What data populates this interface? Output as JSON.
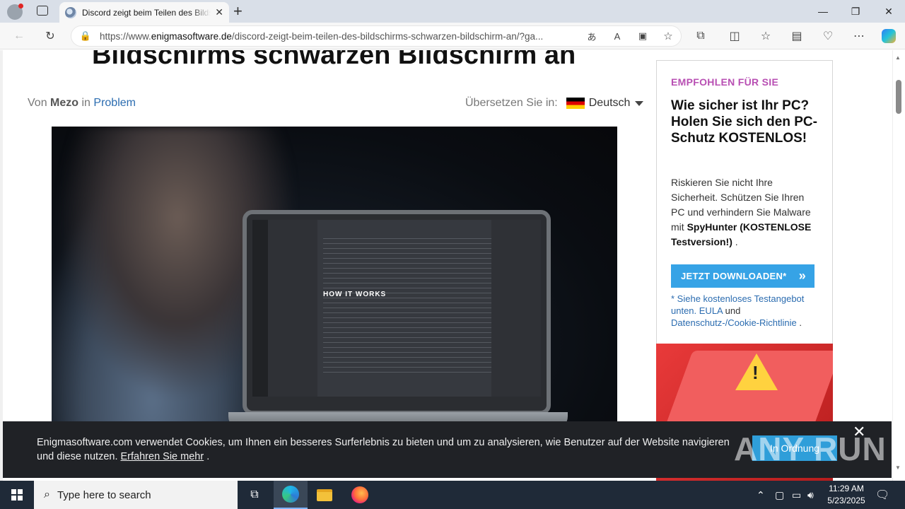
{
  "browser": {
    "tab_title": "Discord zeigt beim Teilen des Bildschirms schwarzen Bildschirm an",
    "url_prefix": "https://www.",
    "url_domain": "enigmasoftware.de",
    "url_path": "/discord-zeigt-beim-teilen-des-bildschirms-schwarzen-bildschirm-an/?ga..."
  },
  "article": {
    "headline": "Bildschirms schwarzen Bildschirm an",
    "by_prefix": "Von",
    "author": "Mezo",
    "in_word": "in",
    "category": "Problem",
    "translate_label": "Übersetzen Sie in:",
    "language": "Deutsch"
  },
  "ad": {
    "kicker": "EMPFOHLEN FÜR SIE",
    "title": "Wie sicher ist Ihr PC? Holen Sie sich den PC-Schutz KOSTENLOS!",
    "body_plain": "Riskieren Sie nicht Ihre Sicherheit. Schützen Sie Ihren PC und verhindern Sie Malware mit ",
    "body_bold": "SpyHunter (KOSTENLOSE Testversion!)",
    "body_end": " .",
    "button": "JETZT DOWNLOADEN*",
    "note_link1": "* Siehe kostenloses Testangebot unten. EULA",
    "note_and": " und ",
    "note_link2": "Datenschutz-/Cookie-Richtlinie",
    "note_end": " ."
  },
  "cookie": {
    "message": "Enigmasoftware.com verwendet Cookies, um Ihnen ein besseres Surferlebnis zu bieten und um zu analysieren, wie Benutzer auf der Website navigieren und diese nutzen. ",
    "link": "Erfahren Sie mehr",
    "after_link": " .",
    "ok": "In Ordnung"
  },
  "watermark": "ANY RUN",
  "hero": {
    "screen_text": "HOW IT WORKS"
  },
  "taskbar": {
    "search_placeholder": "Type here to search",
    "time": "11:29 AM",
    "date": "5/23/2025"
  },
  "colors": {
    "accent_blue": "#2f9ed9",
    "kicker_purple": "#b84fb3",
    "taskbar": "#1f2a38"
  }
}
